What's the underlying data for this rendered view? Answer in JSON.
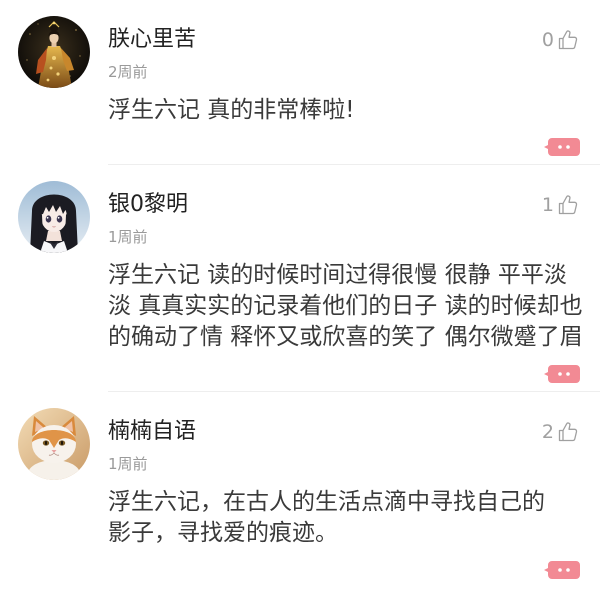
{
  "colors": {
    "background": "#ffffff",
    "username": "#222222",
    "time": "#9a9a9a",
    "text": "#3a3a3a",
    "likes": "#a0a0a0",
    "accent_pink": "#f28a94",
    "divider": "#eeeeee"
  },
  "icons": {
    "like": "thumbs-up-icon",
    "more": "more-dots-icon"
  },
  "comments": [
    {
      "username": "朕心里苦",
      "time": "2周前",
      "likes": "0",
      "text_lines": [
        "浮生六记 真的非常棒啦!"
      ]
    },
    {
      "username": "银0黎明",
      "time": "1周前",
      "likes": "1",
      "text_lines": [
        "浮生六记 读的时候时间过得很慢 很静 平平淡",
        "淡 真真实实的记录着他们的日子 读的时候却也",
        "的确动了情 释怀又或欣喜的笑了 偶尔微蹙了眉"
      ]
    },
    {
      "username": "楠楠自语",
      "time": "1周前",
      "likes": "2",
      "text_lines": [
        "浮生六记，在古人的生活点滴中寻找自己的",
        "影子，寻找爱的痕迹。"
      ]
    }
  ]
}
